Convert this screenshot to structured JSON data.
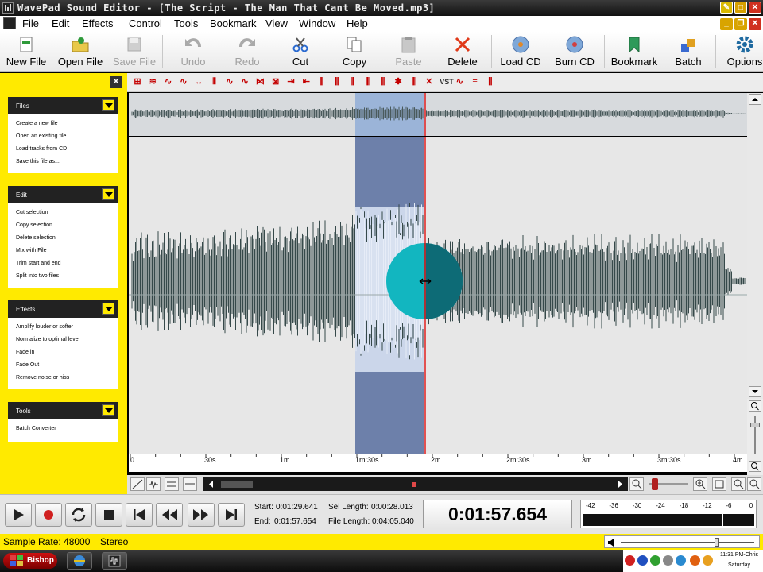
{
  "window": {
    "title": "WavePad Sound Editor - [The Script - The Man That Cant Be Moved.mp3]"
  },
  "menu": [
    "File",
    "Edit",
    "Effects",
    "Control",
    "Tools",
    "Bookmark",
    "View",
    "Window",
    "Help"
  ],
  "toolbar": [
    {
      "label": "New File",
      "icon": "new-file-icon",
      "enabled": true
    },
    {
      "label": "Open File",
      "icon": "open-folder-icon",
      "enabled": true
    },
    {
      "label": "Save File",
      "icon": "save-icon",
      "enabled": false
    },
    {
      "label": "Undo",
      "icon": "undo-icon",
      "enabled": false
    },
    {
      "label": "Redo",
      "icon": "redo-icon",
      "enabled": false
    },
    {
      "label": "Cut",
      "icon": "scissors-icon",
      "enabled": true
    },
    {
      "label": "Copy",
      "icon": "copy-icon",
      "enabled": true
    },
    {
      "label": "Paste",
      "icon": "paste-icon",
      "enabled": false
    },
    {
      "label": "Delete",
      "icon": "delete-icon",
      "enabled": true
    },
    {
      "label": "Load CD",
      "icon": "load-cd-icon",
      "enabled": true
    },
    {
      "label": "Burn CD",
      "icon": "burn-cd-icon",
      "enabled": true
    },
    {
      "label": "Bookmark",
      "icon": "bookmark-icon",
      "enabled": true
    },
    {
      "label": "Batch",
      "icon": "batch-icon",
      "enabled": true
    },
    {
      "label": "Options",
      "icon": "gear-icon",
      "enabled": true
    }
  ],
  "left_panel": {
    "sections": [
      {
        "title": "Files",
        "items": [
          "Create a new file",
          "Open an existing file",
          "Load tracks from CD",
          "Save this file as..."
        ]
      },
      {
        "title": "Edit",
        "items": [
          "Cut selection",
          "Copy selection",
          "Delete selection",
          "Mix with File",
          "Trim start and end",
          "Split into two files"
        ]
      },
      {
        "title": "Effects",
        "items": [
          "Amplify louder or softer",
          "Normalize to optimal level",
          "Fade in",
          "Fade Out",
          "Remove noise or hiss"
        ]
      },
      {
        "title": "Tools",
        "items": [
          "Batch Converter"
        ]
      }
    ]
  },
  "ruler": {
    "ticks": [
      "0",
      "30s",
      "1m",
      "1m:30s",
      "2m",
      "2m:30s",
      "3m",
      "3m:30s",
      "4m"
    ]
  },
  "transport": {
    "start_label": "Start:",
    "start": "0:01:29.641",
    "end_label": "End:",
    "end": "0:01:57.654",
    "sel_length_label": "Sel Length:",
    "sel_length": "0:00:28.013",
    "file_length_label": "File Length:",
    "file_length": "0:04:05.040",
    "current_time": "0:01:57.654",
    "meter_ticks": [
      "-42",
      "-36",
      "-30",
      "-24",
      "-18",
      "-12",
      "-6",
      "0"
    ]
  },
  "status": {
    "sample_rate": "Sample Rate: 48000",
    "channels": "Stereo"
  },
  "taskbar": {
    "start_label": "Bishop",
    "clock_time": "11:31 PM-Chris",
    "clock_day": "Saturday"
  },
  "colors": {
    "accent_yellow": "#ffea00",
    "waveform": "#36494a",
    "selection": "#6d80aa",
    "cursor": "#e02020",
    "cursor_highlight": "#12b6c0"
  }
}
